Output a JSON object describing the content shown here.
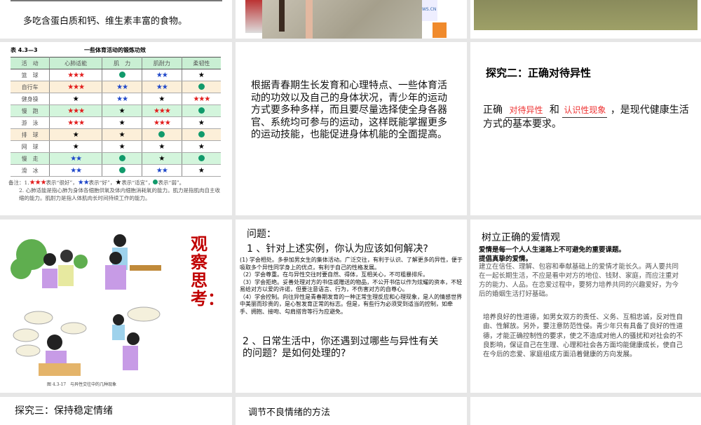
{
  "slides": [
    {
      "text": "多吃含蛋白质和钙、维生素丰富的食物。"
    },
    {
      "photo_label": "WS.CN"
    },
    {},
    {
      "table_no": "表 4.3—3",
      "table_title": "一些体育活动的锻炼功效",
      "headers": [
        "活　动",
        "心肺适能",
        "肌　力",
        "肌耐力",
        "柔韧性"
      ],
      "rows": [
        {
          "name": "篮　球",
          "vals": [
            3,
            0,
            2,
            1
          ],
          "style": ""
        },
        {
          "name": "自行车",
          "vals": [
            3,
            2,
            2,
            0
          ],
          "style": "beige"
        },
        {
          "name": "健身操",
          "vals": [
            1,
            2,
            1,
            3
          ],
          "style": ""
        },
        {
          "name": "慢　跑",
          "vals": [
            3,
            1,
            3,
            0
          ],
          "style": "green"
        },
        {
          "name": "游　泳",
          "vals": [
            3,
            1,
            3,
            1
          ],
          "style": ""
        },
        {
          "name": "排　球",
          "vals": [
            1,
            1,
            0,
            0
          ],
          "style": "beige"
        },
        {
          "name": "网　球",
          "vals": [
            1,
            1,
            1,
            1
          ],
          "style": ""
        },
        {
          "name": "慢　走",
          "vals": [
            2,
            0,
            1,
            0
          ],
          "style": "green"
        },
        {
          "name": "滑　冰",
          "vals": [
            2,
            0,
            2,
            1
          ],
          "style": ""
        }
      ],
      "note_prefix": "备注：1.",
      "note1_parts": [
        "表示“很好”，",
        "表示“好”，",
        "表示“适宜”，",
        "表示“弱”。"
      ],
      "note2": "2. 心肺适能是指心肺为身体各细胞供氧及体内细胞消耗氧的能力。肌力是指肌肉自主收缩的能力。肌耐力是指人体肌肉长时间持续工作的能力。"
    },
    {
      "text": "根据青春期生长发育和心理特点、一些体育活动的功效以及自己的身体状况，青少年的运动方式要多种多样，而且要尽量选择使全身各器官、系统均可参与的运动，这样既能掌握更多的运动技能，也能促进身体机能的全面提高。"
    },
    {
      "title": "探究二：正确对待异性",
      "pre": "正确",
      "blank1": "对待异性",
      "mid": "和",
      "blank2": "认识性现象",
      "post": "，是现代健康生活方式的基本要求。"
    },
    {
      "heading": "观察思考：",
      "caption": "图 4.3-17　与异性交往中的几种现象"
    },
    {
      "label": "问题：",
      "q1": "1 、针对上述实例，你认为应该如何解决?",
      "answers": [
        "(1) 学会相处。多参加男女生的集体活动。广泛交往，有利于认识、了解更多的异性，便于吸取多个异性同学身上的优点，有利于自己的性格发展。",
        "（2）学会尊重。在与异性交往时要自然、得体，互相关心，不可粗暴排斥。",
        "（3）学会拒绝。妥善处理对方的书信或赠送的物品，不公开书信以作为炫耀的资本，不轻易给对方以爱的许诺，但要注意语言、行为，不伤害对方的自尊心。",
        "（4）学会控制。向往异性是青春期发育的一种正常生理反应和心理现象，是人的情感世界中美丽而珍贵的，是心智发育正常的标志。但是，有些行为必须受到适当的控制，如牵手、拥抱、接吻、勾肩搭背等行为应避免。"
      ],
      "q2": "2 、日常生活中，你还遇到过哪些与异性有关的问题？是如何处理的?"
    },
    {
      "title": "树立正确的爱情观",
      "bold1": "爱情是每一个人人生道路上不可避免的重要课题。",
      "bold2": "提倡真挚的爱情。",
      "p1": "建立在信任、理解、包容和奉献基础上的爱情才能长久。两人要共同在一起长期生活，不应是看中对方的地位、钱财、家庭，而应注重对方的能力、人品。在恋爱过程中，要努力培养共同的兴趣爱好，为今后的婚姻生活打好基础。",
      "p2": "培养良好的性道德，如男女双方的责任、义务、互相忠诚，反对性自由、性解放。另外，要注意防范性侵。青少年只有具备了良好的性道德，才能正确控制性的要求，使之不造成对他人的骚扰和对社会的不良影响，保证自己在生理、心理和社会各方面均能健康成长，使自己在今后的恋爱、家庭组成方面沿着健康的方向发展。"
    },
    {
      "title": "探究三：保持稳定情绪"
    },
    {
      "title": "调节不良情绪的方法"
    },
    {}
  ]
}
